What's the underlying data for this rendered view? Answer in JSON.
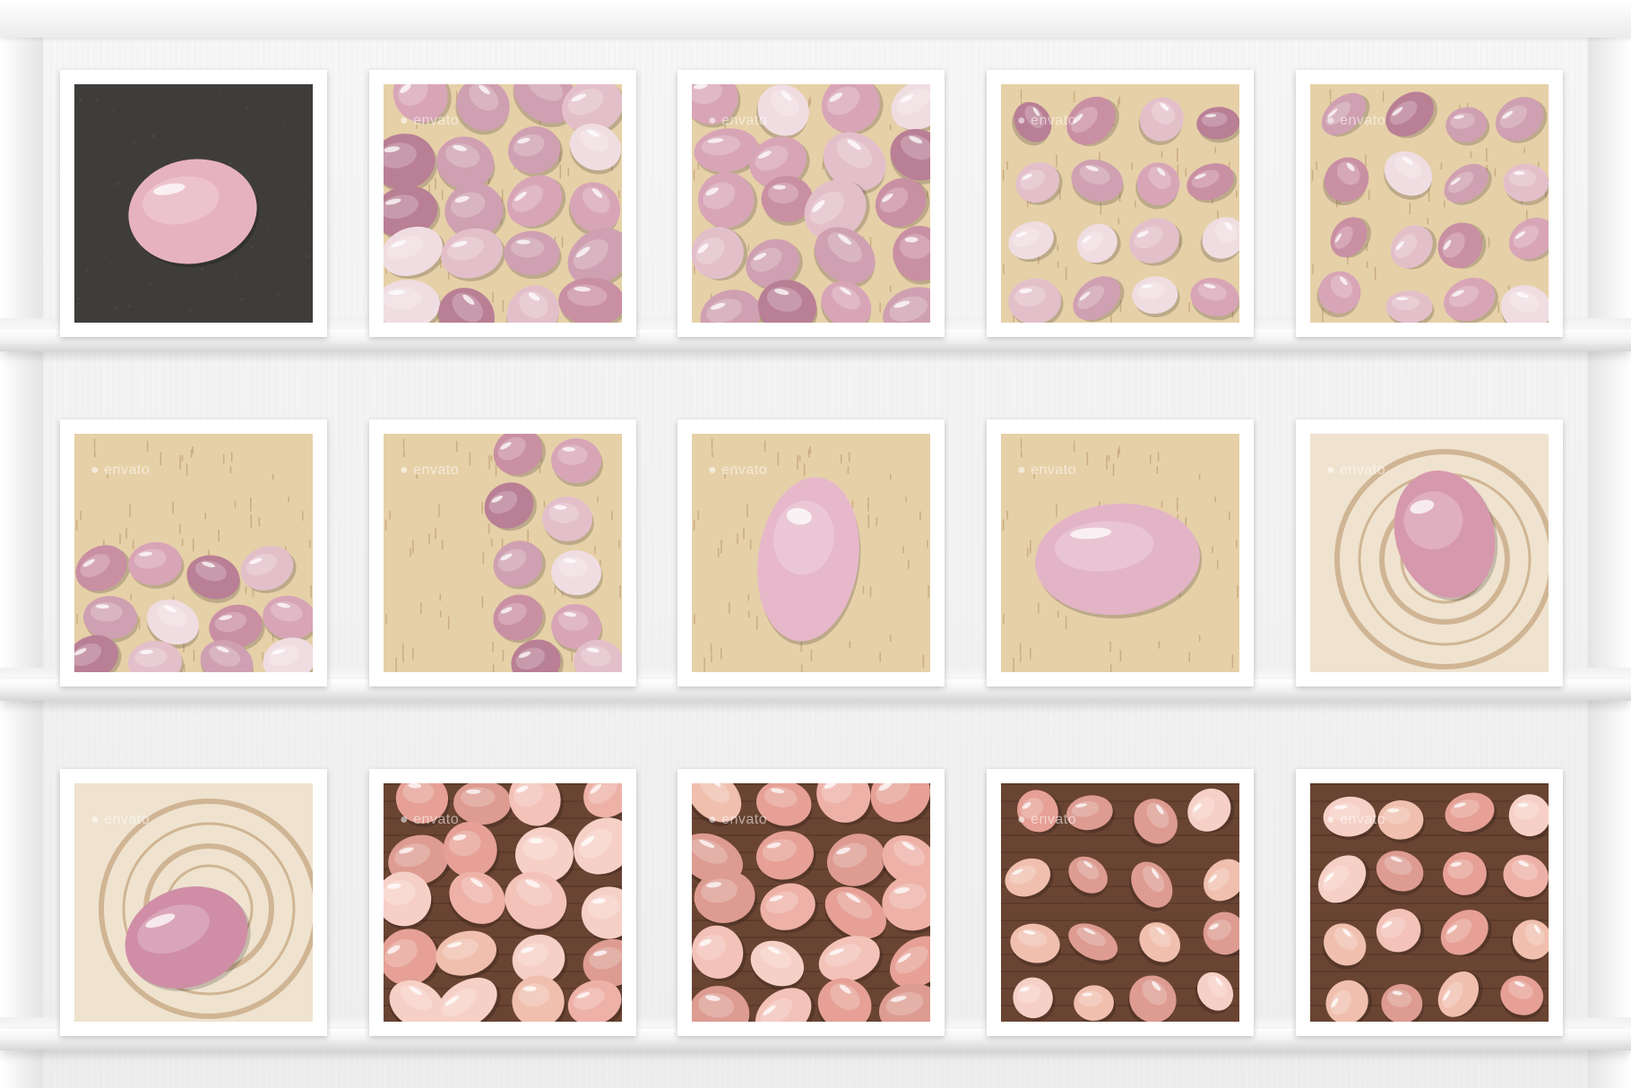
{
  "watermark_text": "envato",
  "colors": {
    "shelf": "#f5f5f5",
    "frame": "#ffffff",
    "quartz_pink": "#e7b2bf",
    "quartz_mauve": "#c98fa3",
    "quartz_peach": "#eeb1a7",
    "wood_light": "#e6d0a8",
    "wood_dark": "#6a4432",
    "slate": "#3f3d3b"
  },
  "rows": [
    {
      "tiles": [
        {
          "id": "r1t1",
          "scene": "slate-single"
        },
        {
          "id": "r1t2",
          "scene": "pile-mauve"
        },
        {
          "id": "r1t3",
          "scene": "pile-mauve"
        },
        {
          "id": "r1t4",
          "scene": "scatter-wood-mauve"
        },
        {
          "id": "r1t5",
          "scene": "scatter-wood-mauve"
        }
      ]
    },
    {
      "tiles": [
        {
          "id": "r2t1",
          "scene": "wood-row-bottom"
        },
        {
          "id": "r2t2",
          "scene": "wood-column-right"
        },
        {
          "id": "r2t3",
          "scene": "wood-single-tall"
        },
        {
          "id": "r2t4",
          "scene": "wood-single-wide"
        },
        {
          "id": "r2t5",
          "scene": "log-single"
        }
      ]
    },
    {
      "tiles": [
        {
          "id": "r3t1",
          "scene": "log-single-low"
        },
        {
          "id": "r3t2",
          "scene": "pile-peach"
        },
        {
          "id": "r3t3",
          "scene": "pile-peach"
        },
        {
          "id": "r3t4",
          "scene": "scatter-dark-peach"
        },
        {
          "id": "r3t5",
          "scene": "scatter-dark-peach"
        }
      ]
    }
  ]
}
